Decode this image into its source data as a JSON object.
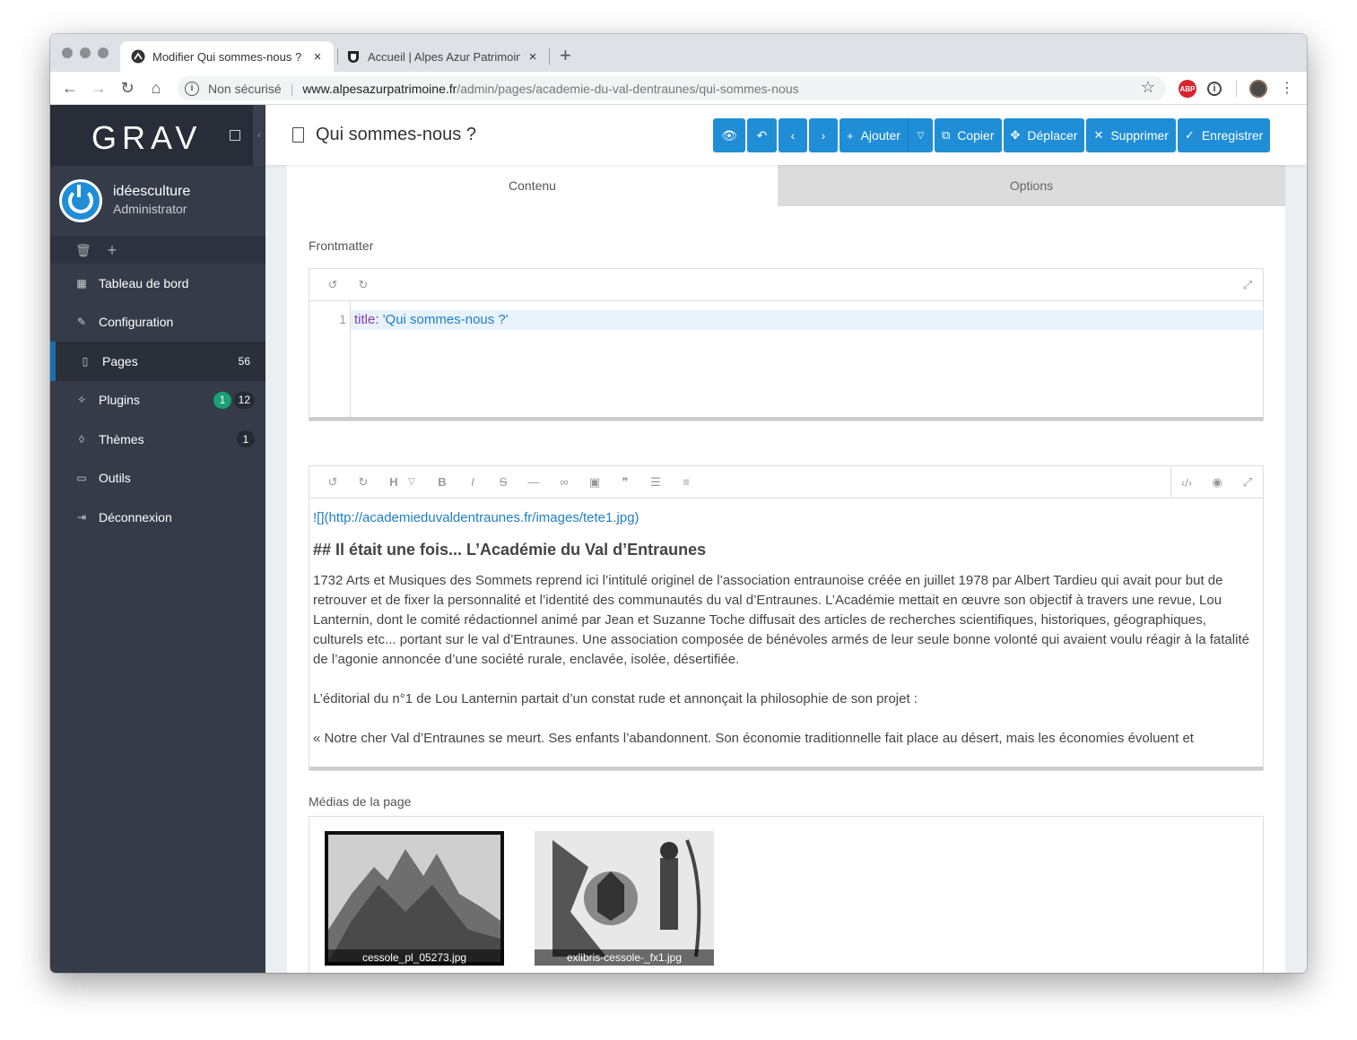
{
  "browser": {
    "tabs": [
      {
        "title": "Modifier Qui sommes-nous ? |",
        "active": true
      },
      {
        "title": "Accueil | Alpes Azur Patrimoine",
        "active": false
      }
    ],
    "new_tab": "+",
    "close": "×",
    "url": {
      "security": "Non sécurisé",
      "domain": "www.alpesazurpatrimoine.fr",
      "path": "/admin/pages/academie-du-val-dentraunes/qui-sommes-nous"
    },
    "extensions": {
      "adblock": "ABP",
      "info": "i"
    }
  },
  "sidebar": {
    "logo": "GRAV",
    "user": {
      "name": "idéesculture",
      "role": "Administrator"
    },
    "nav": [
      {
        "label": "Tableau de bord",
        "icon": "dashboard-icon",
        "glyph": "▦"
      },
      {
        "label": "Configuration",
        "icon": "wrench-icon",
        "glyph": "✎"
      },
      {
        "label": "Pages",
        "icon": "file-icon",
        "glyph": "▯",
        "count": "56",
        "active": true
      },
      {
        "label": "Plugins",
        "icon": "plug-icon",
        "glyph": "✧",
        "count": "12",
        "update": "1"
      },
      {
        "label": "Thèmes",
        "icon": "tint-icon",
        "glyph": "◊",
        "count": "1"
      },
      {
        "label": "Outils",
        "icon": "toolbox-icon",
        "glyph": "▭"
      },
      {
        "label": "Déconnexion",
        "icon": "sign-out-icon",
        "glyph": "⇥"
      }
    ]
  },
  "header": {
    "title": "Qui sommes-nous ?",
    "buttons": {
      "ajouter": "Ajouter",
      "copier": "Copier",
      "deplacer": "Déplacer",
      "supprimer": "Supprimer",
      "enregistrer": "Enregistrer"
    }
  },
  "editor": {
    "tabs": {
      "contenu": "Contenu",
      "options": "Options"
    },
    "frontmatter_label": "Frontmatter",
    "frontmatter": {
      "line_no": "1",
      "key": "title",
      "value": "'Qui sommes-nous ?'"
    },
    "content": {
      "image_link": "![](http://academieduvaldentraunes.fr/images/tete1.jpg)",
      "heading": "## Il était une fois... L’Académie du Val d’Entraunes",
      "p1": "1732 Arts et Musiques des Sommets reprend ici l’intitulé originel de l’association entraunoise créée en juillet 1978 par Albert Tardieu qui avait pour but de retrouver et de fixer la personnalité et l’identité des communautés du val d’Entraunes. L’Académie mettait en œuvre son objectif à travers une revue, Lou Lanternin, dont le comité rédactionnel animé par Jean et Suzanne Toche diffusait des articles de recherches scientifiques, historiques, géographiques, culturels etc... portant sur le val d’Entraunes. Une association composée de bénévoles armés de  leur seule bonne volonté qui avaient voulu réagir à la fatalité de l’agonie annoncée d’une société rurale, enclavée, isolée, désertifiée.",
      "p2": "L’éditorial du n°1 de Lou Lanternin partait  d’un constat rude et annonçait la  philosophie de son  projet :",
      "p3": "« Notre cher Val d’Entraunes se meurt. Ses enfants l’abandonnent. Son économie traditionnelle fait place au désert, mais les économies évoluent et"
    },
    "media_label": "Médias de la page",
    "media": [
      {
        "file": "cessole_pl_05273.jpg"
      },
      {
        "file": "exlibris-cessole-_fx1.jpg"
      }
    ]
  },
  "colors": {
    "accent": "#1f8ed6",
    "sidebar": "#353b48",
    "badge_green": "#1aa073"
  }
}
